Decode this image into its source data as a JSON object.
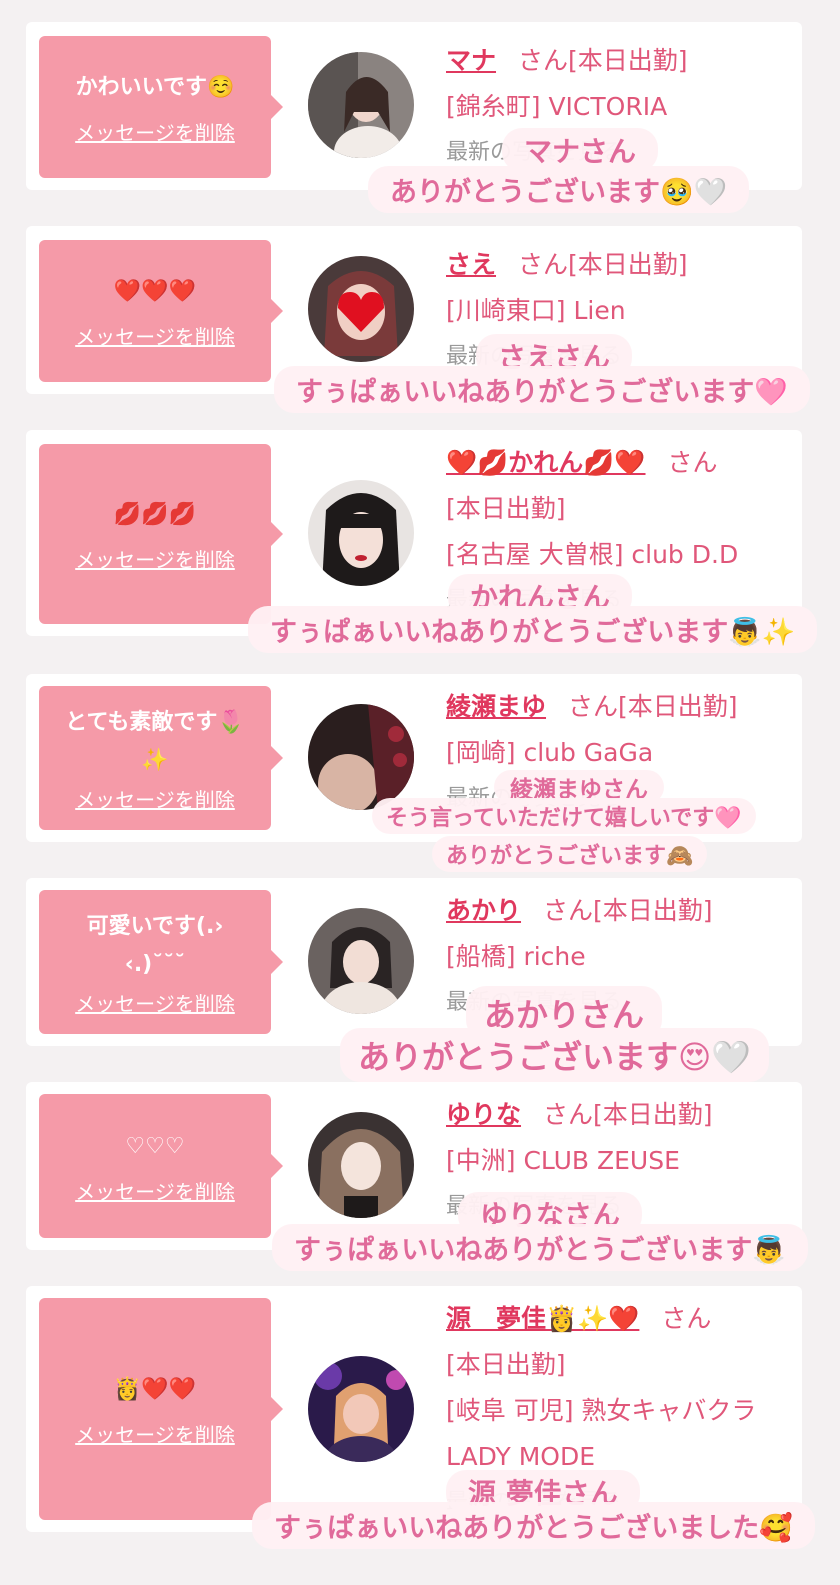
{
  "delete_label": "メッセージを削除",
  "san_label": "さん",
  "latest_label": "最新の写真を見る",
  "cards": [
    {
      "message": "かわいいです☺️",
      "name": "マナ",
      "status": "[本日出勤]",
      "shop": "[錦糸町] VICTORIA",
      "overlay_name": "マナさん",
      "overlay_msg": "ありがとうございます🥹🤍"
    },
    {
      "message": "❤️❤️❤️",
      "name": "さえ",
      "status": "[本日出勤]",
      "shop": "[川崎東口] Lien",
      "overlay_name": "さえさん",
      "overlay_msg": "すぅぱぁいいねありがとうございます🩷"
    },
    {
      "message": "💋💋💋",
      "name": "❤️💋かれん💋❤️",
      "status": "[本日出勤]",
      "shop": "[名古屋 大曽根] club D.D",
      "overlay_name": "かれんさん",
      "overlay_msg": "すぅぱぁいいねありがとうございます👼✨"
    },
    {
      "message": "とても素敵です🌷✨",
      "name": "綾瀬まゆ",
      "status": "[本日出勤]",
      "shop": "[岡崎] club GaGa",
      "overlay_name": "綾瀬まゆさん",
      "overlay_msg": "そう言っていただけて嬉しいです🩷",
      "overlay_msg2": "ありがとうございます🙈"
    },
    {
      "message": "可愛いです(.› ‹.)˘˘˘",
      "name": "あかり",
      "status": "[本日出勤]",
      "shop": "[船橋] riche",
      "overlay_name": "あかりさん",
      "overlay_msg": "ありがとうございます😍🤍"
    },
    {
      "message": "♡♡♡",
      "name": "ゆりな",
      "status": "[本日出勤]",
      "shop": "[中洲] CLUB ZEUSE",
      "overlay_name": "ゆりなさん",
      "overlay_msg": "すぅぱぁいいねありがとうございます👼"
    },
    {
      "message": "👸❤️❤️",
      "name": "源　夢佳👸✨❤️",
      "status": "[本日出勤]",
      "shop": "[岐阜 可児] 熟女キャバクラ LADY MODE",
      "overlay_name": "源 夢佳さん",
      "overlay_msg": "すぅぱぁいいねありがとうございました🥰"
    }
  ]
}
